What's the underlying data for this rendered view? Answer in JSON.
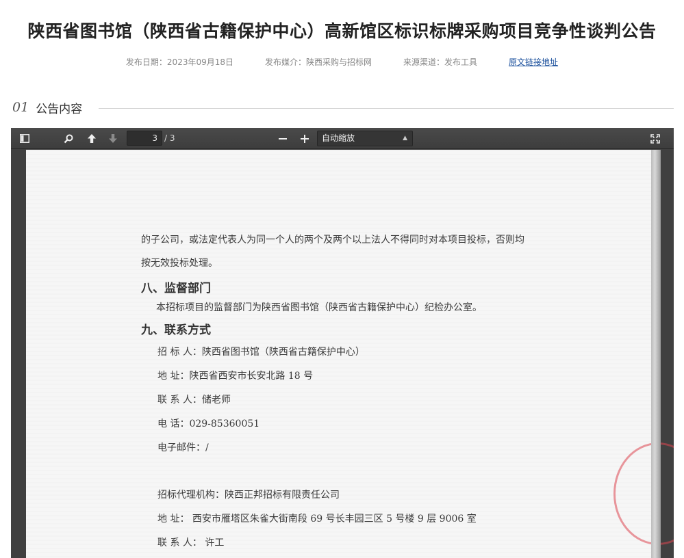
{
  "header": {
    "title": "陕西省图书馆（陕西省古籍保护中心）高新馆区标识标牌采购项目竞争性谈判公告",
    "publish_date": "发布日期：2023年09月18日",
    "media": "发布媒介：陕西采购与招标网",
    "source": "来源渠道：发布工具",
    "link_label": "原文链接地址"
  },
  "section": {
    "number": "01",
    "title": "公告内容"
  },
  "viewer": {
    "current_page": "3",
    "total_pages": "/ 3",
    "zoom_label": "自动缩放",
    "icons": {
      "sidebar": "sidebar-toggle-icon",
      "search": "search-icon",
      "prev": "arrow-up-icon",
      "next": "arrow-down-icon",
      "zoom_out": "minus-icon",
      "zoom_in": "plus-icon",
      "fullscreen": "fullscreen-icon",
      "caret": "caret-icon"
    }
  },
  "document": {
    "line1": "的子公司，或法定代表人为同一个人的两个及两个以上法人不得同时对本项目投标，否则均",
    "line2": "按无效投标处理。",
    "heading8": "八、监督部门",
    "supervise": "本招标项目的监督部门为陕西省图书馆（陕西省古籍保护中心）纪检办公室。",
    "heading9": "九、联系方式",
    "tenderer": "招  标  人：陕西省图书馆（陕西省古籍保护中心）",
    "address1": "地        址：陕西省西安市长安北路 18 号",
    "contact1": "联  系  人：储老师",
    "phone": "电        话：029-85360051",
    "email": "电子邮件：/",
    "agency": "招标代理机构：陕西正邦招标有限责任公司",
    "address2": "地        址：  西安市雁塔区朱雀大街南段 69 号长丰园三区 5 号楼 9 层 9006 室",
    "contact2": "联  系  人：  许工"
  }
}
